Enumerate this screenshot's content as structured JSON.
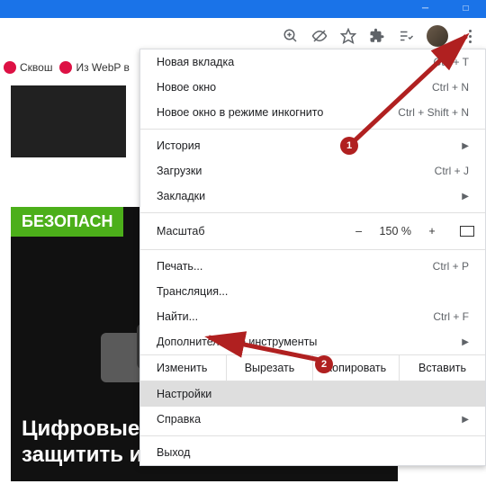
{
  "bookmarks": {
    "item1_label": "Сквош",
    "item2_label": "Из WebP в"
  },
  "menu": {
    "new_tab": "Новая вкладка",
    "new_tab_sc": "Ctrl + T",
    "new_window": "Новое окно",
    "new_window_sc": "Ctrl + N",
    "incognito": "Новое окно в режиме инкогнито",
    "incognito_sc": "Ctrl + Shift + N",
    "history": "История",
    "downloads": "Загрузки",
    "downloads_sc": "Ctrl + J",
    "bookmarks": "Закладки",
    "zoom_label": "Масштаб",
    "zoom_value": "150 %",
    "zoom_minus": "–",
    "zoom_plus": "+",
    "print": "Печать...",
    "print_sc": "Ctrl + P",
    "cast": "Трансляция...",
    "find": "Найти...",
    "find_sc": "Ctrl + F",
    "more_tools": "Дополнительные инструменты",
    "edit": "Изменить",
    "cut": "Вырезать",
    "copy": "Копировать",
    "paste": "Вставить",
    "settings": "Настройки",
    "help": "Справка",
    "exit": "Выход"
  },
  "page": {
    "badge": "БЕЗОПАСН",
    "headline": "Цифровые кошельки. Как защитить и сохранить."
  },
  "annotations": {
    "n1": "1",
    "n2": "2"
  }
}
